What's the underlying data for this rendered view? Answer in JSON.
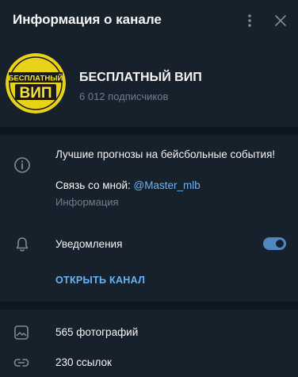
{
  "header": {
    "title": "Информация о канале",
    "more_icon": "more-vertical-icon",
    "close_icon": "close-icon"
  },
  "profile": {
    "name": "БЕСПЛАТНЫЙ ВИП",
    "subscribers": "6 012 подписчиков",
    "avatar_text_top": "БЕСПЛАТНЫЙ",
    "avatar_text_bottom": "ВИП"
  },
  "about": {
    "description": "Лучшие прогнозы на бейсбольные события!",
    "contact_prefix": "Связь со мной: ",
    "contact_link": "@Master_mlb",
    "label": "Информация"
  },
  "notifications": {
    "label": "Уведомления",
    "enabled": true
  },
  "open_channel": "ОТКРЫТЬ КАНАЛ",
  "media": [
    {
      "icon": "photo-icon",
      "label": "565 фотографий"
    },
    {
      "icon": "link-icon",
      "label": "230 ссылок"
    }
  ],
  "colors": {
    "background": "#17212b",
    "divider": "#0e1621",
    "accent": "#6ab3f3",
    "toggle": "#5288c1",
    "secondary_text": "#6d7f8f"
  }
}
